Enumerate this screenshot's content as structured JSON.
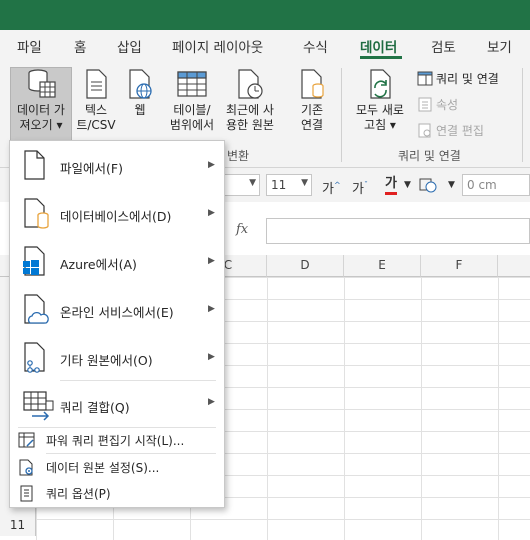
{
  "menu": {
    "tabs": [
      "파일",
      "홈",
      "삽입",
      "페이지 레이아웃",
      "수식",
      "데이터",
      "검토",
      "보기"
    ],
    "active_tab": "데이터"
  },
  "ribbon": {
    "get_data": {
      "line1": "데이터 가",
      "line2": "져오기 ▾"
    },
    "text_csv": {
      "line1": "텍스",
      "line2": "트/CSV"
    },
    "web": {
      "line1": "웹",
      "line2": ""
    },
    "table_range": {
      "line1": "테이블/",
      "line2": "범위에서"
    },
    "recent_sources": {
      "line1": "최근에 사",
      "line2": "용한 원본"
    },
    "existing_connections": {
      "line1": "기존",
      "line2": "연결"
    },
    "refresh_all": {
      "line1": "모두 새로",
      "line2": "고침 ▾"
    },
    "queries_connections": "쿼리 및 연결",
    "properties": "속성",
    "edit_links": "연결 편집",
    "group_transform_partial": "변환",
    "group_queries": "쿼리 및 연결"
  },
  "font_toolbar": {
    "font_size": "11",
    "increase_font": "가",
    "decrease_font": "가",
    "font_color": "가",
    "width_value": "0 cm"
  },
  "formula_bar": {
    "fx": "fx"
  },
  "columns": [
    "C",
    "D",
    "E",
    "F"
  ],
  "rows": [
    "11"
  ],
  "dropdown_menu": {
    "items": [
      {
        "label": "파일에서(F)"
      },
      {
        "label": "데이터베이스에서(D)"
      },
      {
        "label": "Azure에서(A)"
      },
      {
        "label": "온라인 서비스에서(E)"
      },
      {
        "label": "기타 원본에서(O)"
      },
      {
        "label": "쿼리 결합(Q)"
      }
    ],
    "small_items": [
      {
        "label": "파워 쿼리 편집기 시작(L)..."
      },
      {
        "label": "데이터 원본 설정(S)..."
      },
      {
        "label": "쿼리 옵션(P)"
      }
    ]
  },
  "colors": {
    "excel_green": "#217346",
    "ribbon_bg": "#f3f3f3",
    "azure_blue": "#0078d4",
    "db_orange": "#e8a33d"
  }
}
